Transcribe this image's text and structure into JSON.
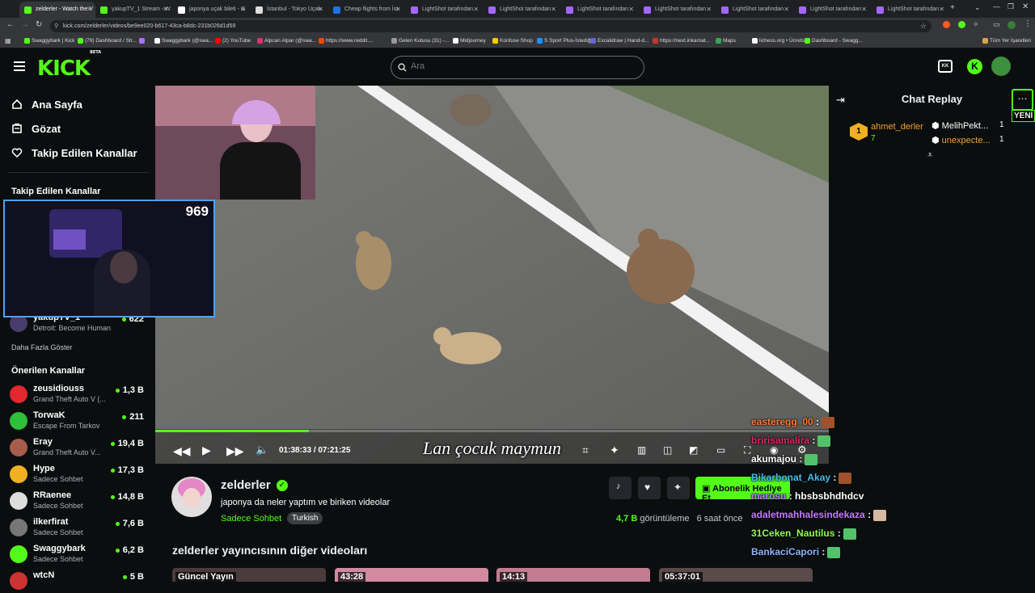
{
  "browser": {
    "tabs": [
      {
        "label": "zelderler - Watch the V",
        "active": true,
        "color": "#53fc18"
      },
      {
        "label": "yakupTV_1 Stream - W",
        "color": "#53fc18"
      },
      {
        "label": "japonya uçak bileti - G",
        "color": "#ffffff"
      },
      {
        "label": "İstanbul - Tokyo Uçak",
        "color": "#dddddd"
      },
      {
        "label": "Cheap flights from İst",
        "color": "#1a73e8"
      },
      {
        "label": "LightShot tarafından",
        "color": "#a367ff"
      },
      {
        "label": "LightShot tarafından",
        "color": "#a367ff"
      },
      {
        "label": "LightShot tarafından",
        "color": "#a367ff"
      },
      {
        "label": "LightShot tarafından",
        "color": "#a367ff"
      },
      {
        "label": "LightShot tarafından",
        "color": "#a367ff"
      },
      {
        "label": "LightShot tarafından",
        "color": "#a367ff"
      },
      {
        "label": "LightShot tarafından",
        "color": "#a367ff"
      }
    ],
    "url": "kick.com/zelderler/videos/be9ee020-b617-43ca-b8dc-231b026d1d59",
    "bookmarks": [
      {
        "label": "Swaggybark | Kick",
        "color": "#53fc18"
      },
      {
        "label": "(79) Dashboard / Str...",
        "color": "#53fc18"
      },
      {
        "label": "",
        "color": "#a970ff"
      },
      {
        "label": "Swaggybark (@swa...",
        "color": "#ffffff"
      },
      {
        "label": "(2) YouTube",
        "color": "#ff0000"
      },
      {
        "label": "Alpcan Alpar (@swa...",
        "color": "#e1306c"
      },
      {
        "label": "https://www.reddit....",
        "color": "#ff4500"
      },
      {
        "label": "Gelen Kutusu (31) -...",
        "color": "#999999"
      },
      {
        "label": "Midjourney",
        "color": "#ffffff"
      },
      {
        "label": "Konfuse Shop",
        "color": "#ffcc00"
      },
      {
        "label": "S Sport Plus-İstediği...",
        "color": "#1e90ff"
      },
      {
        "label": "Excalidraw | Hand-d...",
        "color": "#6965db"
      },
      {
        "label": "https://next.inkarnat...",
        "color": "#c0392b"
      },
      {
        "label": "Maps",
        "color": "#34a853"
      },
      {
        "label": "lichess.org • Ücretsi...",
        "color": "#ffffff"
      },
      {
        "label": "Dashboard - Swagg...",
        "color": "#53fc18"
      }
    ],
    "all_bookmarks": "Tüm Yer İşaretleri"
  },
  "header": {
    "logo": "KICK",
    "logo_beta": "BETA",
    "search_placeholder": "Ara"
  },
  "sidebar": {
    "nav": [
      {
        "label": "Ana Sayfa",
        "icon": "home-icon"
      },
      {
        "label": "Gözat",
        "icon": "browse-icon"
      },
      {
        "label": "Takip Edilen Kanallar",
        "icon": "heart-icon"
      }
    ],
    "followed_heading": "Takip Edilen Kanallar",
    "followed": [
      {
        "name": "yakupTV_1",
        "category": "Detroit: Become Human",
        "viewers": "622"
      }
    ],
    "show_more": "Daha Fazla Göster",
    "recommended_heading": "Önerilen Kanallar",
    "recommended": [
      {
        "name": "zeusidiouss",
        "category": "Grand Theft Auto V (...",
        "viewers": "1,3 B",
        "color": "#e3262f"
      },
      {
        "name": "TorwaK",
        "category": "Escape From Tarkov",
        "viewers": "211",
        "color": "#2fbf3a"
      },
      {
        "name": "Eray",
        "category": "Grand Theft Auto V...",
        "viewers": "19,4 B",
        "color": "#a85c4a"
      },
      {
        "name": "Hype",
        "category": "Sadece Sohbet",
        "viewers": "17,3 B",
        "color": "#f0b020"
      },
      {
        "name": "RRaenee",
        "category": "Sadece Sohbet",
        "viewers": "14,8 B",
        "color": "#dddddd"
      },
      {
        "name": "ilkerfirat",
        "category": "Sadece Sohbet",
        "viewers": "7,6 B",
        "color": "#777777"
      },
      {
        "name": "Swaggybark",
        "category": "Sadece Sohbet",
        "viewers": "6,2 B",
        "color": "#53fc18"
      },
      {
        "name": "wtcN",
        "category": "",
        "viewers": "5 B",
        "color": "#cc3333"
      }
    ]
  },
  "pip": {
    "viewer_count": "969"
  },
  "player": {
    "subtitle": "Lan çocuk maymun",
    "current_time": "01:38:33",
    "time_sep": "/",
    "duration": "07:21:25",
    "progress": 0.228
  },
  "video_info": {
    "channel": "zelderler",
    "title": "japonya da neler yaptım ve biriken videolar",
    "category": "Sadece Sohbet",
    "tag": "Turkish",
    "views": "4,7 B",
    "views_label": "görüntüleme",
    "age": "6 saat önce",
    "gift_label": "Abonelik Hediye Et"
  },
  "more_videos": {
    "heading": "zelderler yayıncısının diğer videoları",
    "items": [
      {
        "label": "Güncel Yayın",
        "color": "#4a3c3c"
      },
      {
        "label": "43:28",
        "color": "#d28aa0"
      },
      {
        "label": "14:13",
        "color": "#c37c91"
      },
      {
        "label": "05:37:01",
        "color": "#5a4a4a"
      }
    ]
  },
  "chat": {
    "title": "Chat Replay",
    "new_badge": "YENİ",
    "leaderboard": [
      {
        "rank": "1",
        "name": "ahmet_derler",
        "count": "7",
        "color": "#f0a030"
      },
      {
        "name": "MelihPekt...",
        "count": "1",
        "color": "#ffffff"
      },
      {
        "name": "unexpecte...",
        "count": "1",
        "color": "#f0a030"
      }
    ],
    "overlay_messages": [
      {
        "user": "easteregg_00",
        "text": ":",
        "color": "#ff7b39"
      },
      {
        "user": "bririsamalira",
        "text": ":",
        "color": "#e8246a"
      },
      {
        "user": "akumajou",
        "text": ":",
        "color": "#ffffff"
      },
      {
        "user": "Bikarbonat_Akay",
        "text": ":",
        "color": "#3fc2f0"
      },
      {
        "user": "marosu",
        "text": ": hbsbsbhdhdcv",
        "color": "#b57aff"
      },
      {
        "user": "adaletmahhalesindekaza",
        "text": ":",
        "color": "#c77dff"
      },
      {
        "user": "31Ceken_Nautilus",
        "text": ":",
        "color": "#90ff50"
      },
      {
        "user": "BankaciCapori",
        "text": ":",
        "color": "#8fb4ff"
      }
    ]
  }
}
